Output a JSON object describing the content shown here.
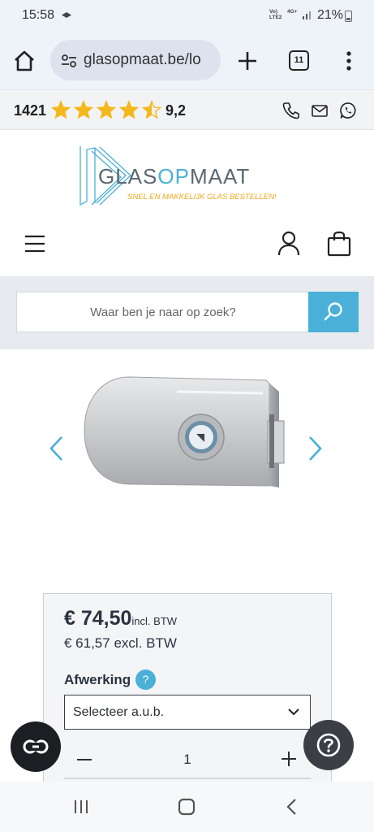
{
  "status_bar": {
    "time": "15:58",
    "network_top": "Vo)",
    "network_bottom": "LTE2",
    "network2_top": "4G+",
    "network2_bottom": "",
    "battery": "21%"
  },
  "browser": {
    "url": "glasopmaat.be/lo",
    "tab_count": "11"
  },
  "rating": {
    "count": "1421",
    "stars": 4.5,
    "score": "9,2"
  },
  "logo": {
    "name_part1": "GLAS",
    "name_part2": "OP",
    "name_part3": "MAAT",
    "tagline": "SNEL EN MAKKELIJK GLAS BESTELLEN!"
  },
  "search": {
    "placeholder": "Waar ben je naar op zoek?"
  },
  "product": {
    "price": "€ 74,50",
    "price_incl": "incl. BTW",
    "price_excl": "€ 61,57 excl. BTW",
    "finish_label": "Afwerking",
    "help_mark": "?",
    "finish_select_value": "Selecteer a.u.b.",
    "quantity": "1"
  },
  "colors": {
    "accent": "#4ab0d8",
    "star": "#f4b81c",
    "logo_orange": "#f2a81d",
    "logo_grey": "#5b6770",
    "dark_text": "#2a3340"
  },
  "icons": {
    "home": "home-icon",
    "site_info": "tune-icon",
    "new_tab": "plus-icon",
    "more": "more-vert-icon",
    "phone": "phone-icon",
    "mail": "mail-icon",
    "whatsapp": "whatsapp-icon",
    "menu": "hamburger-icon",
    "account": "user-icon",
    "cart": "bag-icon",
    "search": "search-icon",
    "chat": "chat-icon",
    "help": "help-icon"
  }
}
